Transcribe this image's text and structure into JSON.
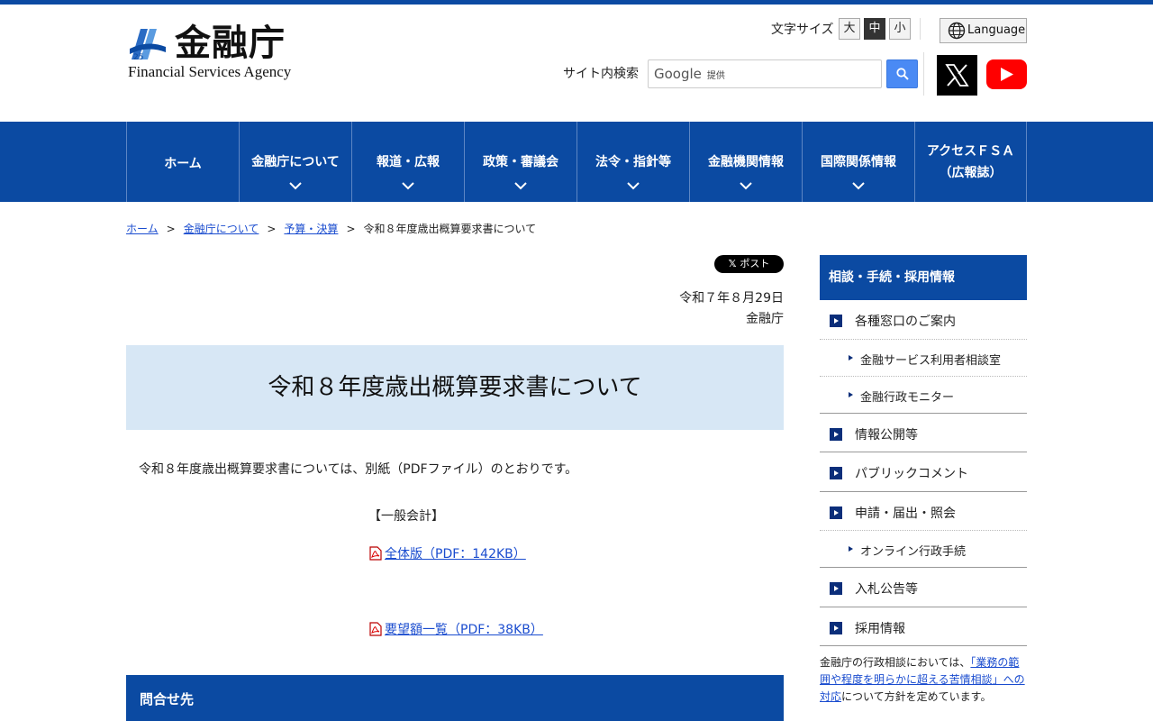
{
  "header": {
    "logo_jp": "金融庁",
    "logo_en": "Financial Services Agency",
    "font_size_label": "文字サイズ",
    "font_sizes": [
      "大",
      "中",
      "小"
    ],
    "font_size_selected": "中",
    "language_label": "Language",
    "search_label": "サイト内検索",
    "search_brand": "Google",
    "search_provided": "提供"
  },
  "nav": {
    "items": [
      {
        "label": "ホーム",
        "has_dropdown": false
      },
      {
        "label": "金融庁について",
        "has_dropdown": true
      },
      {
        "label": "報道・広報",
        "has_dropdown": true
      },
      {
        "label": "政策・審議会",
        "has_dropdown": true
      },
      {
        "label": "法令・指針等",
        "has_dropdown": true
      },
      {
        "label": "金融機関情報",
        "has_dropdown": true
      },
      {
        "label": "国際関係情報",
        "has_dropdown": true
      },
      {
        "label_line1": "アクセスＦＳＡ",
        "label_line2": "（広報誌）",
        "has_dropdown": false
      }
    ]
  },
  "breadcrumb": {
    "items": [
      "ホーム",
      "金融庁について",
      "予算・決算"
    ],
    "current": "令和８年度歳出概算要求書について",
    "separator": ">"
  },
  "main": {
    "post_label": "ポスト",
    "date": "令和７年８月29日",
    "agency": "金融庁",
    "title": "令和８年度歳出概算要求書について",
    "intro": "令和８年度歳出概算要求書については、別紙（PDFファイル）のとおりです。",
    "section_label": "【一般会計】",
    "links": [
      {
        "label": "全体版（PDF：142KB）"
      },
      {
        "label": "要望額一覧（PDF：38KB）"
      }
    ],
    "contact_heading": "問合せ先"
  },
  "sidebar": {
    "heading": "相談・手続・採用情報",
    "items": [
      {
        "label": "各種窓口のご案内",
        "sub": [
          "金融サービス利用者相談室",
          "金融行政モニター"
        ]
      },
      {
        "label": "情報公開等",
        "sub": []
      },
      {
        "label": "パブリックコメント",
        "sub": []
      },
      {
        "label": "申請・届出・照会",
        "sub": [
          "オンライン行政手続"
        ]
      },
      {
        "label": "入札公告等",
        "sub": []
      },
      {
        "label": "採用情報",
        "sub": []
      }
    ],
    "note_before": "金融庁の行政相談においては、",
    "note_link": "「業務の範囲や程度を明らかに超える苦情相談」への対応",
    "note_after": "について方針を定めています。"
  },
  "colors": {
    "brand_blue": "#0b4aa2",
    "title_bg": "#d7e7f5",
    "link": "#1a4ccf"
  }
}
